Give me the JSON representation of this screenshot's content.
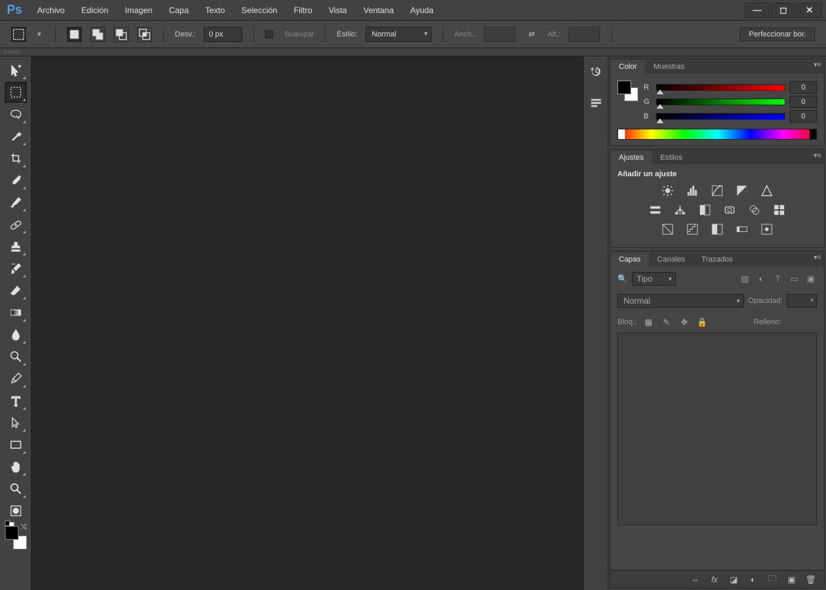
{
  "app": {
    "logo": "Ps"
  },
  "menu": [
    "Archivo",
    "Edición",
    "Imagen",
    "Capa",
    "Texto",
    "Selección",
    "Filtro",
    "Vista",
    "Ventana",
    "Ayuda"
  ],
  "options": {
    "feather_label": "Desv.:",
    "feather_value": "0 px",
    "antialias_label": "Suavizar",
    "style_label": "Estilo:",
    "style_value": "Normal",
    "width_label": "Anch.:",
    "height_label": "Alt.:",
    "refine_label": "Perfeccionar bor."
  },
  "tools": [
    {
      "name": "move-tool",
      "icon": "move"
    },
    {
      "name": "marquee-tool",
      "icon": "marquee",
      "active": true
    },
    {
      "name": "lasso-tool",
      "icon": "lasso"
    },
    {
      "name": "magic-wand-tool",
      "icon": "wand"
    },
    {
      "name": "crop-tool",
      "icon": "crop"
    },
    {
      "name": "eyedropper-tool",
      "icon": "eyedropper"
    },
    {
      "name": "brush-tool",
      "icon": "brush"
    },
    {
      "name": "healing-brush-tool",
      "icon": "bandaid"
    },
    {
      "name": "clone-stamp-tool",
      "icon": "stamp"
    },
    {
      "name": "history-brush-tool",
      "icon": "history"
    },
    {
      "name": "eraser-tool",
      "icon": "eraser"
    },
    {
      "name": "gradient-tool",
      "icon": "gradient"
    },
    {
      "name": "blur-tool",
      "icon": "blur"
    },
    {
      "name": "dodge-tool",
      "icon": "dodge"
    },
    {
      "name": "pen-tool",
      "icon": "pen"
    },
    {
      "name": "type-tool",
      "icon": "type"
    },
    {
      "name": "path-selection-tool",
      "icon": "pathsel"
    },
    {
      "name": "shape-tool",
      "icon": "rect"
    },
    {
      "name": "hand-tool",
      "icon": "hand"
    },
    {
      "name": "zoom-tool",
      "icon": "zoom"
    }
  ],
  "colorpanel": {
    "tabs": [
      "Color",
      "Muestras"
    ],
    "channels": [
      {
        "label": "R",
        "value": "0",
        "gradient": "linear-gradient(90deg,#000,#f00)"
      },
      {
        "label": "G",
        "value": "0",
        "gradient": "linear-gradient(90deg,#000,#0f0)"
      },
      {
        "label": "B",
        "value": "0",
        "gradient": "linear-gradient(90deg,#000,#00f)"
      }
    ]
  },
  "adjpanel": {
    "tabs": [
      "Ajustes",
      "Estilos"
    ],
    "title": "Añadir un ajuste"
  },
  "layerspanel": {
    "tabs": [
      "Capas",
      "Canales",
      "Trazados"
    ],
    "filter_label": "Tipo",
    "blend_value": "Normal",
    "opacity_label": "Opacidad:",
    "lock_label": "Bloq.:",
    "fill_label": "Relleno:"
  }
}
